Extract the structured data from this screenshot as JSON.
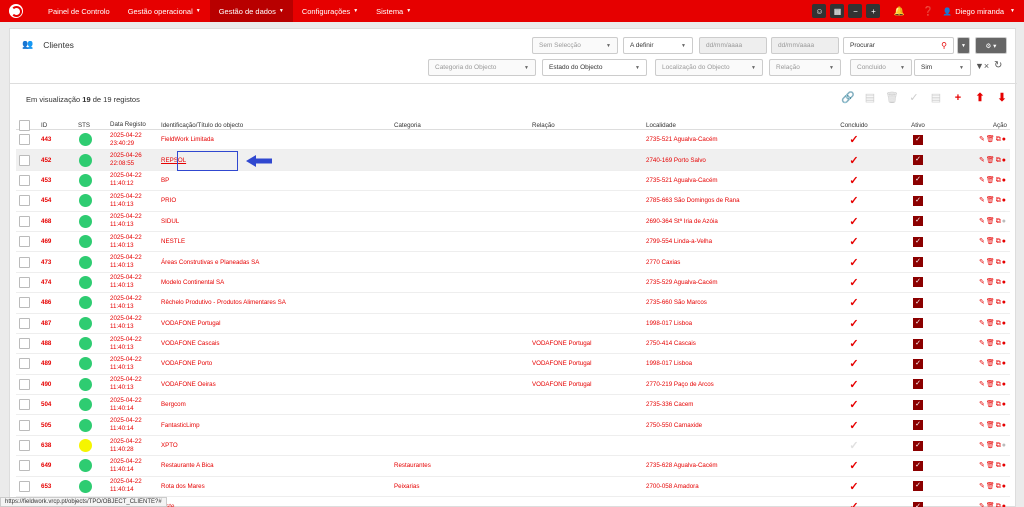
{
  "nav": {
    "items": [
      {
        "label": "Painel de Controlo",
        "caret": false,
        "active": false
      },
      {
        "label": "Gestão operacional",
        "caret": true,
        "active": false
      },
      {
        "label": "Gestão de dados",
        "caret": true,
        "active": true
      },
      {
        "label": "Configurações",
        "caret": true,
        "active": false
      },
      {
        "label": "Sistema",
        "caret": true,
        "active": false
      }
    ],
    "user": "Diego miranda",
    "icons": [
      "chat-icon",
      "card-icon",
      "minus-icon",
      "plus-icon",
      "bell-icon",
      "help-icon",
      "user-icon"
    ]
  },
  "page": {
    "title": "Clientes",
    "count_prefix": "Em visualização",
    "count_shown": "19",
    "count_mid": "de 19 registos"
  },
  "filters": {
    "sem_seleccao": "Sem Selecção",
    "a_definir": "A definir",
    "date1": "dd/mm/aaaa",
    "date2": "dd/mm/aaaa",
    "procurar": "Procurar",
    "categoria": "Categoria do Objecto",
    "estado": "Estado do Objecto",
    "localizacao": "Localização do Objecto",
    "relacao": "Relação",
    "concluido": "Concluido",
    "sim": "Sim"
  },
  "table": {
    "headers": {
      "id": "ID",
      "sts": "STS",
      "date": "Data Registo",
      "title": "Identificação/Título do objecto",
      "cat": "Categoria",
      "rel": "Relação",
      "loc": "Localidade",
      "conc": "Concluido",
      "ativo": "Ativo",
      "acao": "Ação"
    },
    "rows": [
      {
        "id": "443",
        "sts": "#2ecc71",
        "d1": "2025-04-22",
        "d2": "23:40:29",
        "title": "FieldWork Limitada",
        "cat": "",
        "rel": "",
        "loc": "2735-521 Agualva-Cacém",
        "conc": true,
        "map": true
      },
      {
        "id": "452",
        "sts": "#2ecc71",
        "d1": "2025-04-26",
        "d2": "22:08:55",
        "title": "REPSOL",
        "cat": "",
        "rel": "",
        "loc": "2740-169 Porto Salvo",
        "conc": true,
        "map": true
      },
      {
        "id": "453",
        "sts": "#2ecc71",
        "d1": "2025-04-22",
        "d2": "11:40:12",
        "title": "BP",
        "cat": "",
        "rel": "",
        "loc": "2735-521 Agualva-Cacém",
        "conc": true,
        "map": true
      },
      {
        "id": "454",
        "sts": "#2ecc71",
        "d1": "2025-04-22",
        "d2": "11:40:13",
        "title": "PRIO",
        "cat": "",
        "rel": "",
        "loc": "2785-663 São Domingos de Rana",
        "conc": true,
        "map": true
      },
      {
        "id": "468",
        "sts": "#2ecc71",
        "d1": "2025-04-22",
        "d2": "11:40:13",
        "title": "SIDUL",
        "cat": "",
        "rel": "",
        "loc": "2690-364 Stª Iria de Azóia",
        "conc": true,
        "map": false
      },
      {
        "id": "469",
        "sts": "#2ecc71",
        "d1": "2025-04-22",
        "d2": "11:40:13",
        "title": "NESTLE",
        "cat": "",
        "rel": "",
        "loc": "2799-554 Linda-a-Velha",
        "conc": true,
        "map": true
      },
      {
        "id": "473",
        "sts": "#2ecc71",
        "d1": "2025-04-22",
        "d2": "11:40:13",
        "title": "Áreas Construtivas e Planeadas SA",
        "cat": "",
        "rel": "",
        "loc": "2770 Caxias",
        "conc": true,
        "map": true
      },
      {
        "id": "474",
        "sts": "#2ecc71",
        "d1": "2025-04-22",
        "d2": "11:40:13",
        "title": "Modelo Continental SA",
        "cat": "",
        "rel": "",
        "loc": "2735-529 Agualva-Cacém",
        "conc": true,
        "map": true
      },
      {
        "id": "486",
        "sts": "#2ecc71",
        "d1": "2025-04-22",
        "d2": "11:40:13",
        "title": "Rêchelo Produtivo - Produtos Alimentares SA",
        "cat": "",
        "rel": "",
        "loc": "2735-660 São Marcos",
        "conc": true,
        "map": true
      },
      {
        "id": "487",
        "sts": "#2ecc71",
        "d1": "2025-04-22",
        "d2": "11:40:13",
        "title": "VODAFONE Portugal",
        "cat": "",
        "rel": "",
        "loc": "1998-017 Lisboa",
        "conc": true,
        "map": true
      },
      {
        "id": "488",
        "sts": "#2ecc71",
        "d1": "2025-04-22",
        "d2": "11:40:13",
        "title": "VODAFONE Cascais",
        "cat": "",
        "rel": "VODAFONE Portugal",
        "loc": "2750-414 Cascais",
        "conc": true,
        "map": true
      },
      {
        "id": "489",
        "sts": "#2ecc71",
        "d1": "2025-04-22",
        "d2": "11:40:13",
        "title": "VODAFONE Porto",
        "cat": "",
        "rel": "VODAFONE Portugal",
        "loc": "1998-017 Lisboa",
        "conc": true,
        "map": true
      },
      {
        "id": "490",
        "sts": "#2ecc71",
        "d1": "2025-04-22",
        "d2": "11:40:13",
        "title": "VODAFONE Oeiras",
        "cat": "",
        "rel": "VODAFONE Portugal",
        "loc": "2770-219 Paço de Arcos",
        "conc": true,
        "map": true
      },
      {
        "id": "504",
        "sts": "#2ecc71",
        "d1": "2025-04-22",
        "d2": "11:40:14",
        "title": "Bergcom",
        "cat": "",
        "rel": "",
        "loc": "2735-336 Cacem",
        "conc": true,
        "map": true
      },
      {
        "id": "505",
        "sts": "#2ecc71",
        "d1": "2025-04-22",
        "d2": "11:40:14",
        "title": "FantasticLimp",
        "cat": "",
        "rel": "",
        "loc": "2750-550 Carnaxide",
        "conc": true,
        "map": true
      },
      {
        "id": "638",
        "sts": "#f5f500",
        "d1": "2025-04-22",
        "d2": "11:40:28",
        "title": "XPTO",
        "cat": "",
        "rel": "",
        "loc": "",
        "conc": false,
        "map": false
      },
      {
        "id": "649",
        "sts": "#2ecc71",
        "d1": "2025-04-22",
        "d2": "11:40:14",
        "title": "Restaurante A Bica",
        "cat": "Restaurantes",
        "rel": "",
        "loc": "2735-628 Agualva-Cacém",
        "conc": true,
        "map": true
      },
      {
        "id": "653",
        "sts": "#2ecc71",
        "d1": "2025-04-22",
        "d2": "11:40:14",
        "title": "Rota dos Mares",
        "cat": "Peixarias",
        "rel": "",
        "loc": "2700-058 Amadora",
        "conc": true,
        "map": true
      },
      {
        "id": "",
        "sts": "",
        "d1": "",
        "d2": "",
        "title": "teste",
        "cat": "",
        "rel": "",
        "loc": "",
        "conc": true,
        "map": true
      }
    ]
  },
  "statusbar": {
    "url": "https://fieldwork.vrcp.pt/objects/TPO/OBJECT_CLIENTE?#"
  },
  "colors": {
    "brand": "#e60000",
    "highlight": "#3048d0"
  }
}
